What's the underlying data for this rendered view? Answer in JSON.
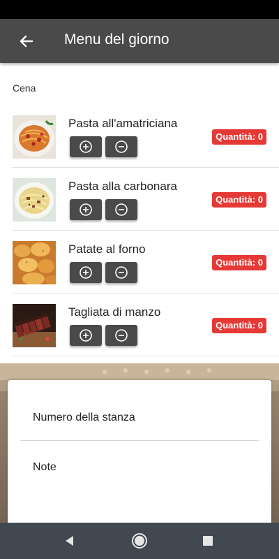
{
  "header": {
    "title": "Menu del giorno",
    "back_icon": "arrow-left-icon"
  },
  "section": {
    "label": "Cena"
  },
  "items": [
    {
      "name": "Pasta all'amatriciana",
      "quantity": "Quantità: 0",
      "image": "pasta-amatriciana-photo"
    },
    {
      "name": "Pasta alla carbonara",
      "quantity": "Quantità: 0",
      "image": "pasta-carbonara-photo"
    },
    {
      "name": "Patate al forno",
      "quantity": "Quantità: 0",
      "image": "roasted-potatoes-photo"
    },
    {
      "name": "Tagliata di manzo",
      "quantity": "Quantità: 0",
      "image": "sliced-beef-photo"
    }
  ],
  "form": {
    "room_label": "Numero della stanza",
    "notes_label": "Note"
  },
  "nav": {
    "back": "nav-back-icon",
    "home": "nav-home-icon",
    "recents": "nav-recents-icon"
  },
  "colors": {
    "app_bar": "#4a4a4a",
    "badge": "#e53935",
    "button": "#4a4a4a",
    "nav_bar": "#424850"
  }
}
